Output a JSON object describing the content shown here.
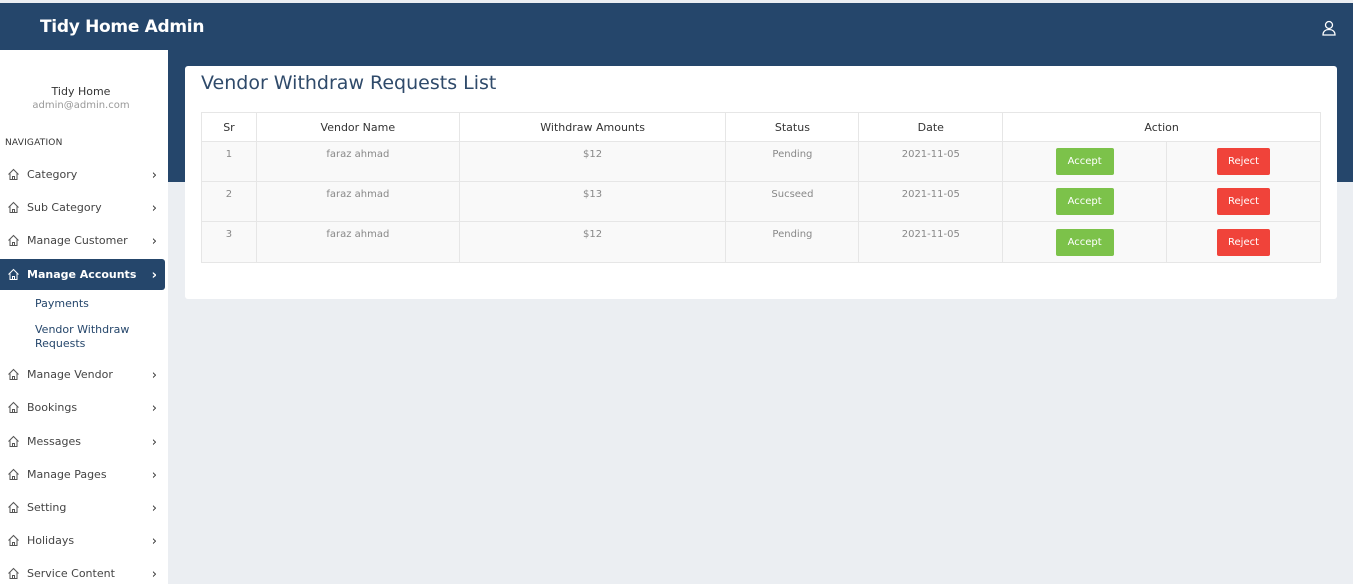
{
  "header": {
    "brand": "Tidy Home Admin"
  },
  "profile": {
    "name": "Tidy Home",
    "email": "admin@admin.com"
  },
  "nav": {
    "heading": "NAVIGATION",
    "items": [
      {
        "label": "Category"
      },
      {
        "label": "Sub Category"
      },
      {
        "label": "Manage Customer"
      },
      {
        "label": "Manage Accounts"
      },
      {
        "label": "Manage Vendor"
      },
      {
        "label": "Bookings"
      },
      {
        "label": "Messages"
      },
      {
        "label": "Manage Pages"
      },
      {
        "label": "Setting"
      },
      {
        "label": "Holidays"
      },
      {
        "label": "Service Content"
      }
    ],
    "subitems": [
      {
        "label": "Payments"
      },
      {
        "label": "Vendor Withdraw Requests"
      }
    ]
  },
  "main": {
    "title": "Vendor Withdraw Requests List",
    "columns": [
      "Sr",
      "Vendor Name",
      "Withdraw Amounts",
      "Status",
      "Date",
      "Action"
    ],
    "rows": [
      {
        "sr": "1",
        "vendor": "faraz ahmad",
        "amount": "$12",
        "status": "Pending",
        "date": "2021-11-05"
      },
      {
        "sr": "2",
        "vendor": "faraz ahmad",
        "amount": "$13",
        "status": "Sucseed",
        "date": "2021-11-05"
      },
      {
        "sr": "3",
        "vendor": "faraz ahmad",
        "amount": "$12",
        "status": "Pending",
        "date": "2021-11-05"
      }
    ],
    "accept_label": "Accept",
    "reject_label": "Reject"
  },
  "colors": {
    "primary": "#25466b",
    "accept": "#7cc24a",
    "reject": "#f0433a",
    "background": "#ebeef2"
  }
}
